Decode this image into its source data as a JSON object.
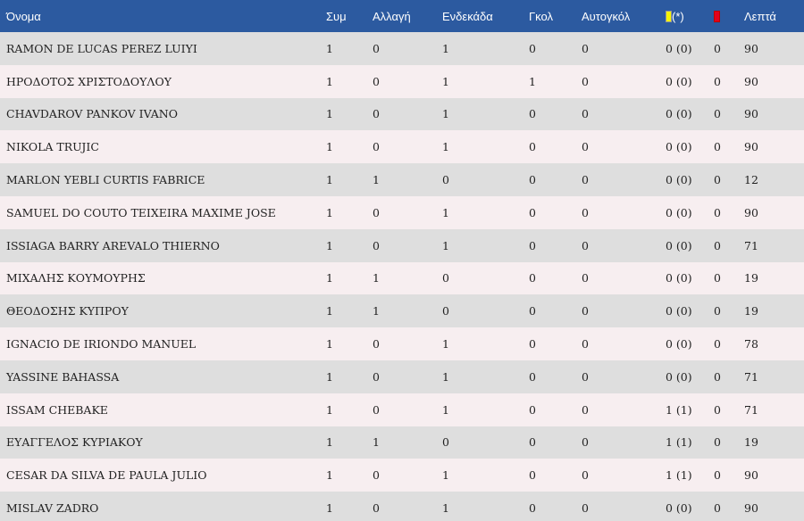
{
  "header": {
    "name": "Όνομα",
    "apps": "Συμ",
    "subs": "Αλλαγή",
    "starting": "Ενδεκάδα",
    "goals": "Γκολ",
    "own_goals": "Αυτογκόλ",
    "yellow_suffix": "(*)",
    "minutes": "Λεπτά",
    "colors": {
      "yellow_card": "#f5f500",
      "red_card": "#e3001b"
    }
  },
  "rows": [
    [
      "RAMON DE LUCAS PEREZ LUIYI",
      "1",
      "0",
      "1",
      "0",
      "0",
      "0 (0)",
      "0",
      "90"
    ],
    [
      "ΗΡΟΔΟΤΟΣ ΧΡΙΣΤΟΔΟΥΛΟΥ",
      "1",
      "0",
      "1",
      "1",
      "0",
      "0 (0)",
      "0",
      "90"
    ],
    [
      "CHAVDAROV PANKOV IVANO",
      "1",
      "0",
      "1",
      "0",
      "0",
      "0 (0)",
      "0",
      "90"
    ],
    [
      "NIKOLA TRUJIC",
      "1",
      "0",
      "1",
      "0",
      "0",
      "0 (0)",
      "0",
      "90"
    ],
    [
      "MARLON YEBLI CURTIS FABRICE",
      "1",
      "1",
      "0",
      "0",
      "0",
      "0 (0)",
      "0",
      "12"
    ],
    [
      "SAMUEL DO COUTO TEIXEIRA MAXIME JOSE",
      "1",
      "0",
      "1",
      "0",
      "0",
      "0 (0)",
      "0",
      "90"
    ],
    [
      "ISSIAGA BARRY AREVALO THIERNO",
      "1",
      "0",
      "1",
      "0",
      "0",
      "0 (0)",
      "0",
      "71"
    ],
    [
      "ΜΙΧΑΛΗΣ ΚΟΥΜΟΥΡΗΣ",
      "1",
      "1",
      "0",
      "0",
      "0",
      "0 (0)",
      "0",
      "19"
    ],
    [
      "ΘΕΟΔΟΣΗΣ ΚΥΠΡΟΥ",
      "1",
      "1",
      "0",
      "0",
      "0",
      "0 (0)",
      "0",
      "19"
    ],
    [
      "IGNACIO DE IRIONDO MANUEL",
      "1",
      "0",
      "1",
      "0",
      "0",
      "0 (0)",
      "0",
      "78"
    ],
    [
      "YASSINE BAHASSA",
      "1",
      "0",
      "1",
      "0",
      "0",
      "0 (0)",
      "0",
      "71"
    ],
    [
      "ISSAM CHEBAKE",
      "1",
      "0",
      "1",
      "0",
      "0",
      "1 (1)",
      "0",
      "71"
    ],
    [
      "ΕΥΑΓΓΕΛΟΣ ΚΥΡΙΑΚΟΥ",
      "1",
      "1",
      "0",
      "0",
      "0",
      "1 (1)",
      "0",
      "19"
    ],
    [
      "CESAR DA SILVA DE PAULA JULIO",
      "1",
      "0",
      "1",
      "0",
      "0",
      "1 (1)",
      "0",
      "90"
    ],
    [
      "MISLAV ZADRO",
      "1",
      "0",
      "1",
      "0",
      "0",
      "0 (0)",
      "0",
      "90"
    ]
  ]
}
